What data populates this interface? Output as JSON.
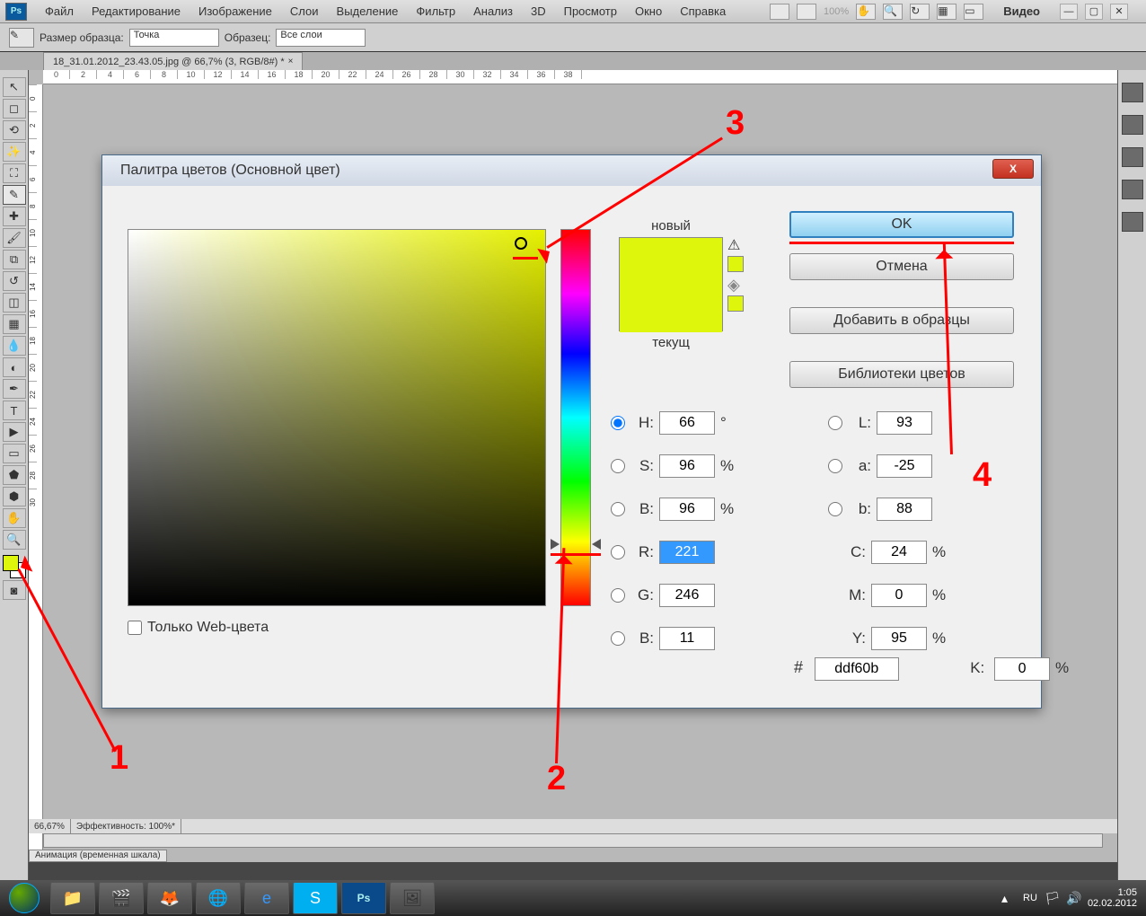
{
  "menubar": {
    "items": [
      "Файл",
      "Редактирование",
      "Изображение",
      "Слои",
      "Выделение",
      "Фильтр",
      "Анализ",
      "3D",
      "Просмотр",
      "Окно",
      "Справка"
    ],
    "zoom": "100%",
    "workspace": "Видео"
  },
  "options": {
    "sample_size_label": "Размер образца:",
    "sample_size_value": "Точка",
    "sample_label": "Образец:",
    "sample_value": "Все слои"
  },
  "tab": {
    "filename": "18_31.01.2012_23.43.05.jpg @ 66,7% (3, RGB/8#) *"
  },
  "status": {
    "zoom": "66,67%",
    "efficiency": "Эффективность: 100%*",
    "animation_panel": "Анимация (временная шкала)"
  },
  "dialog": {
    "title": "Палитра цветов (Основной цвет)",
    "new_label": "новый",
    "current_label": "текущ",
    "ok": "OK",
    "cancel": "Отмена",
    "add_swatch": "Добавить в образцы",
    "color_libs": "Библиотеки цветов",
    "web_only": "Только Web-цвета",
    "fields": {
      "H": {
        "label": "H:",
        "value": "66",
        "unit": "°"
      },
      "S": {
        "label": "S:",
        "value": "96",
        "unit": "%"
      },
      "Bhsb": {
        "label": "B:",
        "value": "96",
        "unit": "%"
      },
      "R": {
        "label": "R:",
        "value": "221",
        "unit": ""
      },
      "G": {
        "label": "G:",
        "value": "246",
        "unit": ""
      },
      "Brgb": {
        "label": "B:",
        "value": "11",
        "unit": ""
      },
      "L": {
        "label": "L:",
        "value": "93",
        "unit": ""
      },
      "a": {
        "label": "a:",
        "value": "-25",
        "unit": ""
      },
      "b": {
        "label": "b:",
        "value": "88",
        "unit": ""
      },
      "C": {
        "label": "C:",
        "value": "24",
        "unit": "%"
      },
      "M": {
        "label": "M:",
        "value": "0",
        "unit": "%"
      },
      "Y": {
        "label": "Y:",
        "value": "95",
        "unit": "%"
      },
      "K": {
        "label": "K:",
        "value": "0",
        "unit": "%"
      }
    },
    "hex": "ddf60b"
  },
  "annotations": {
    "n1": "1",
    "n2": "2",
    "n3": "3",
    "n4": "4"
  },
  "ruler_marks": [
    "0",
    "2",
    "4",
    "6",
    "8",
    "10",
    "12",
    "14",
    "16",
    "18",
    "20",
    "22",
    "24",
    "26",
    "28",
    "30",
    "32",
    "34",
    "36",
    "38"
  ],
  "taskbar": {
    "lang": "RU",
    "time": "1:05",
    "date": "02.02.2012"
  }
}
